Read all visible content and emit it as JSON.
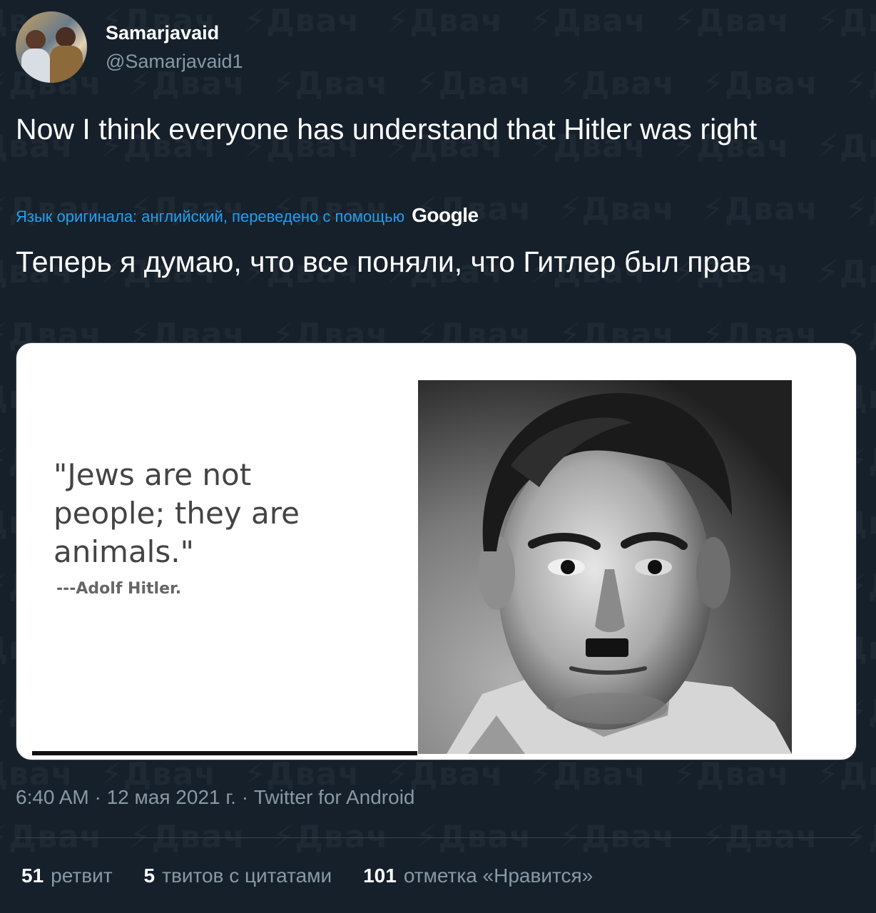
{
  "watermark": {
    "text": "Двач",
    "icon": "lightning-bolt-icon"
  },
  "author": {
    "display_name": "Samarjavaid",
    "handle": "@Samarjavaid1"
  },
  "tweet": {
    "text": "Now I think everyone has understand that Hitler was right",
    "translation_notice": "Язык оригинала: английский, переведено с помощью",
    "translation_provider": "Google",
    "translated_text": "Теперь я думаю, что все поняли, что Гитлер был прав"
  },
  "media": {
    "quote": "\"Jews are not\npeople; they are\nanimals.\"",
    "attribution": "---Adolf Hitler."
  },
  "meta": {
    "timestamp": "6:40 AM · 12 мая 2021 г. · Twitter for Android"
  },
  "stats": [
    {
      "count": "51",
      "label": "ретвит"
    },
    {
      "count": "5",
      "label": "твитов с цитатами"
    },
    {
      "count": "101",
      "label": "отметка «Нравится»"
    }
  ],
  "colors": {
    "background": "#15202b",
    "accent": "#1da1f2",
    "secondary_text": "#8899a6",
    "border": "#38444d"
  }
}
